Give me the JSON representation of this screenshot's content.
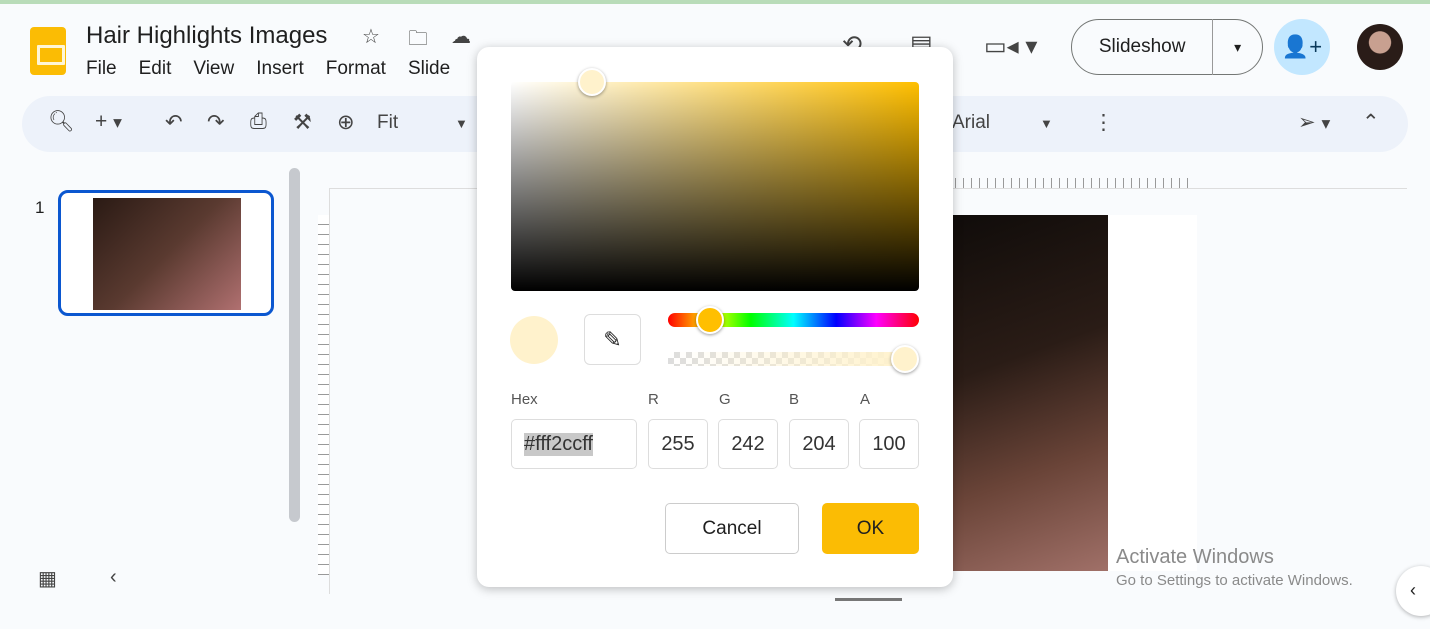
{
  "doc": {
    "title": "Hair Highlights Images",
    "menu": [
      "File",
      "Edit",
      "View",
      "Insert",
      "Format",
      "Slide"
    ]
  },
  "toolbar": {
    "zoom": "Fit",
    "font": "Arial"
  },
  "header": {
    "slideshow": "Slideshow"
  },
  "filmstrip": {
    "slide_number": "1"
  },
  "color_picker": {
    "base_hue": "#ffbf00",
    "selected": "#fff2cc",
    "hex_label": "Hex",
    "r_label": "R",
    "g_label": "G",
    "b_label": "B",
    "a_label": "A",
    "hex": "#fff2ccff",
    "r": "255",
    "g": "242",
    "b": "204",
    "a": "100",
    "cancel": "Cancel",
    "ok": "OK"
  },
  "watermark": {
    "line1": "Activate Windows",
    "line2": "Go to Settings to activate Windows."
  }
}
